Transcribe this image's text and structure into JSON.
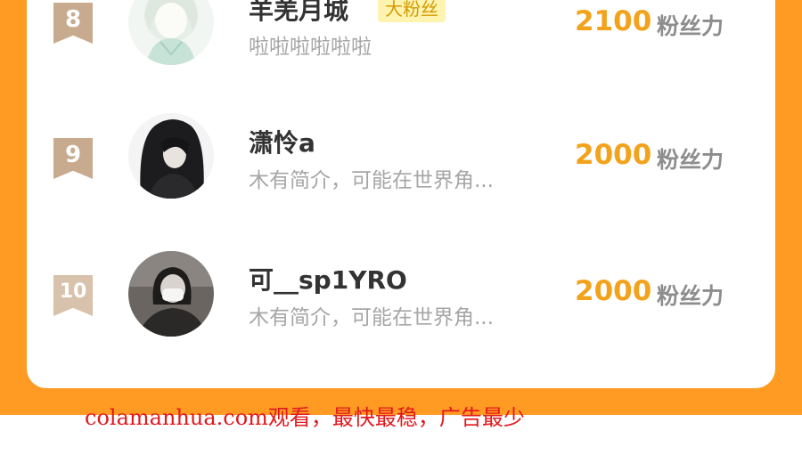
{
  "colors": {
    "page_background": "#ff9a22",
    "score": "#f3a21c",
    "rank_badge": "#c8aa8e",
    "watermark": "#e0191f"
  },
  "rows": [
    {
      "rank": "8",
      "name": "羊羌月城",
      "badge": "大粉丝",
      "bio": "啦啦啦啦啦啦",
      "score": "2100",
      "unit": "粉丝力",
      "avatar_icon": "anime-girl-light-avatar"
    },
    {
      "rank": "9",
      "name": "潇怜a",
      "bio": "木有简介，可能在世界角...",
      "score": "2000",
      "unit": "粉丝力",
      "avatar_icon": "dark-hair-girl-avatar"
    },
    {
      "rank": "10",
      "name": "可__sp1YRO",
      "bio": "木有简介，可能在世界角...",
      "score": "2000",
      "unit": "粉丝力",
      "avatar_icon": "masked-person-photo-avatar"
    }
  ],
  "watermark": "colamanhua.com观看，最快最稳，广告最少"
}
